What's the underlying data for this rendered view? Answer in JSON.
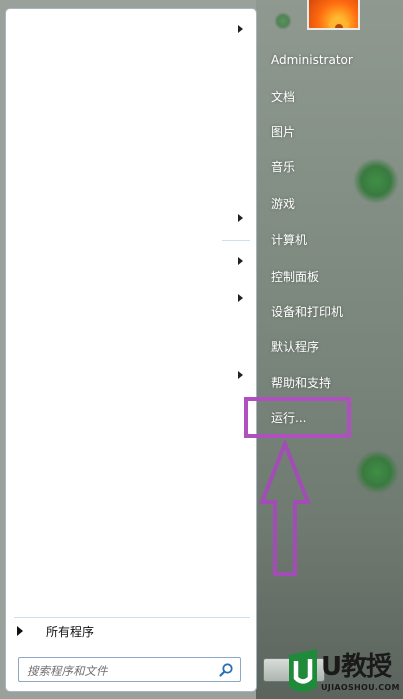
{
  "user": {
    "name": "Administrator"
  },
  "right_items": [
    {
      "label": "文档"
    },
    {
      "label": "图片"
    },
    {
      "label": "音乐"
    },
    {
      "label": "游戏"
    },
    {
      "label": "计算机"
    },
    {
      "label": "控制面板"
    },
    {
      "label": "设备和打印机"
    },
    {
      "label": "默认程序"
    },
    {
      "label": "帮助和支持"
    },
    {
      "label": "运行..."
    }
  ],
  "all_programs": {
    "label": "所有程序"
  },
  "search": {
    "placeholder": "搜索程序和文件"
  },
  "watermark": {
    "main": "U教授",
    "sub": "UJIAOSHOU.COM"
  },
  "colors": {
    "highlight": "#b04fc0",
    "arrow": "#a24db5"
  },
  "icons": {
    "search": "search-icon",
    "submenu": "chevron-right-icon",
    "annotation": "up-arrow-icon"
  }
}
